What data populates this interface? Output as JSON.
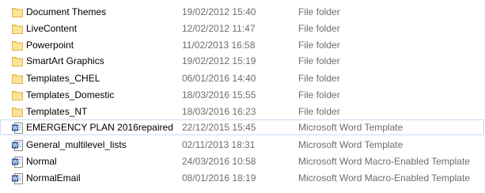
{
  "files": [
    {
      "name": "Document Themes",
      "date": "19/02/2012 15:40",
      "type": "File folder",
      "icon": "folder-icon",
      "selected": false
    },
    {
      "name": "LiveContent",
      "date": "12/02/2012 11:47",
      "type": "File folder",
      "icon": "folder-icon",
      "selected": false
    },
    {
      "name": "Powerpoint",
      "date": "11/02/2013 16:58",
      "type": "File folder",
      "icon": "folder-icon",
      "selected": false
    },
    {
      "name": "SmartArt Graphics",
      "date": "19/02/2012 15:19",
      "type": "File folder",
      "icon": "folder-icon",
      "selected": false
    },
    {
      "name": "Templates_CHEL",
      "date": "06/01/2016 14:40",
      "type": "File folder",
      "icon": "folder-icon",
      "selected": false
    },
    {
      "name": "Templates_Domestic",
      "date": "18/03/2016 15:55",
      "type": "File folder",
      "icon": "folder-icon",
      "selected": false
    },
    {
      "name": "Templates_NT",
      "date": "18/03/2016 16:23",
      "type": "File folder",
      "icon": "folder-icon",
      "selected": false
    },
    {
      "name": "EMERGENCY PLAN 2016repaired",
      "date": "22/12/2015 15:45",
      "type": "Microsoft Word Template",
      "icon": "word-template-icon",
      "selected": true
    },
    {
      "name": "General_multilevel_lists",
      "date": "02/11/2013 18:31",
      "type": "Microsoft Word Template",
      "icon": "word-template-icon",
      "selected": false
    },
    {
      "name": "Normal",
      "date": "24/03/2016 10:58",
      "type": "Microsoft Word Macro-Enabled Template",
      "icon": "word-template-icon",
      "selected": false
    },
    {
      "name": "NormalEmail",
      "date": "08/01/2016 18:19",
      "type": "Microsoft Word Macro-Enabled Template",
      "icon": "word-template-icon",
      "selected": false
    }
  ],
  "colors": {
    "folder": "#f8d775",
    "folder_edge": "#e0b54a",
    "word_blue": "#2b579a",
    "selection_border": "#c8dcf2",
    "secondary_text": "#6d6d6d"
  }
}
